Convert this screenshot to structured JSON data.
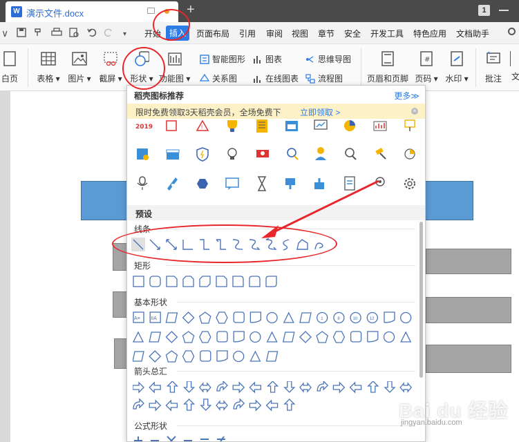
{
  "titlebar": {
    "doc_title": "演示文件.docx",
    "window_number": "1"
  },
  "menu": {
    "items": [
      "开始",
      "插入",
      "页面布局",
      "引用",
      "审阅",
      "视图",
      "章节",
      "安全",
      "开发工具",
      "特色应用",
      "文档助手"
    ],
    "active": "插入"
  },
  "ribbon": {
    "cover_page": "白页",
    "table": "表格",
    "picture": "图片",
    "screenshot": "截屏",
    "shapes": "形状",
    "function_chart": "功能图",
    "smart_shape": "智能图形",
    "chart": "图表",
    "mind_map": "思维导图",
    "relation_chart": "关系图",
    "online_chart": "在线图表",
    "flow_chart": "流程图",
    "header_footer": "页眉和页脚",
    "page_number": "页码",
    "watermark": "水印",
    "comment": "批注",
    "more": "文"
  },
  "popup": {
    "header": "稻壳图标推荐",
    "more": "更多≫",
    "promo_text": "限时免费领取3天稻壳会员，全场免费下",
    "promo_link": "立即领取 >",
    "year_icon": "2019",
    "preset_title": "预设",
    "categories": {
      "lines": "线条",
      "rect": "矩形",
      "basic": "基本形状",
      "arrows": "箭头总汇",
      "formula": "公式形状"
    },
    "basic_labels": [
      "A≡",
      "IIA",
      "1",
      "8",
      "10",
      "12"
    ]
  },
  "watermark": {
    "logo": "Bai du 经验",
    "url": "jingyan.baidu.com"
  },
  "colors": {
    "accent": "#2d7be5",
    "annotation_red": "#e8262b",
    "shape_blue": "#5b9bd5",
    "shape_gray": "#a5a5a5"
  }
}
